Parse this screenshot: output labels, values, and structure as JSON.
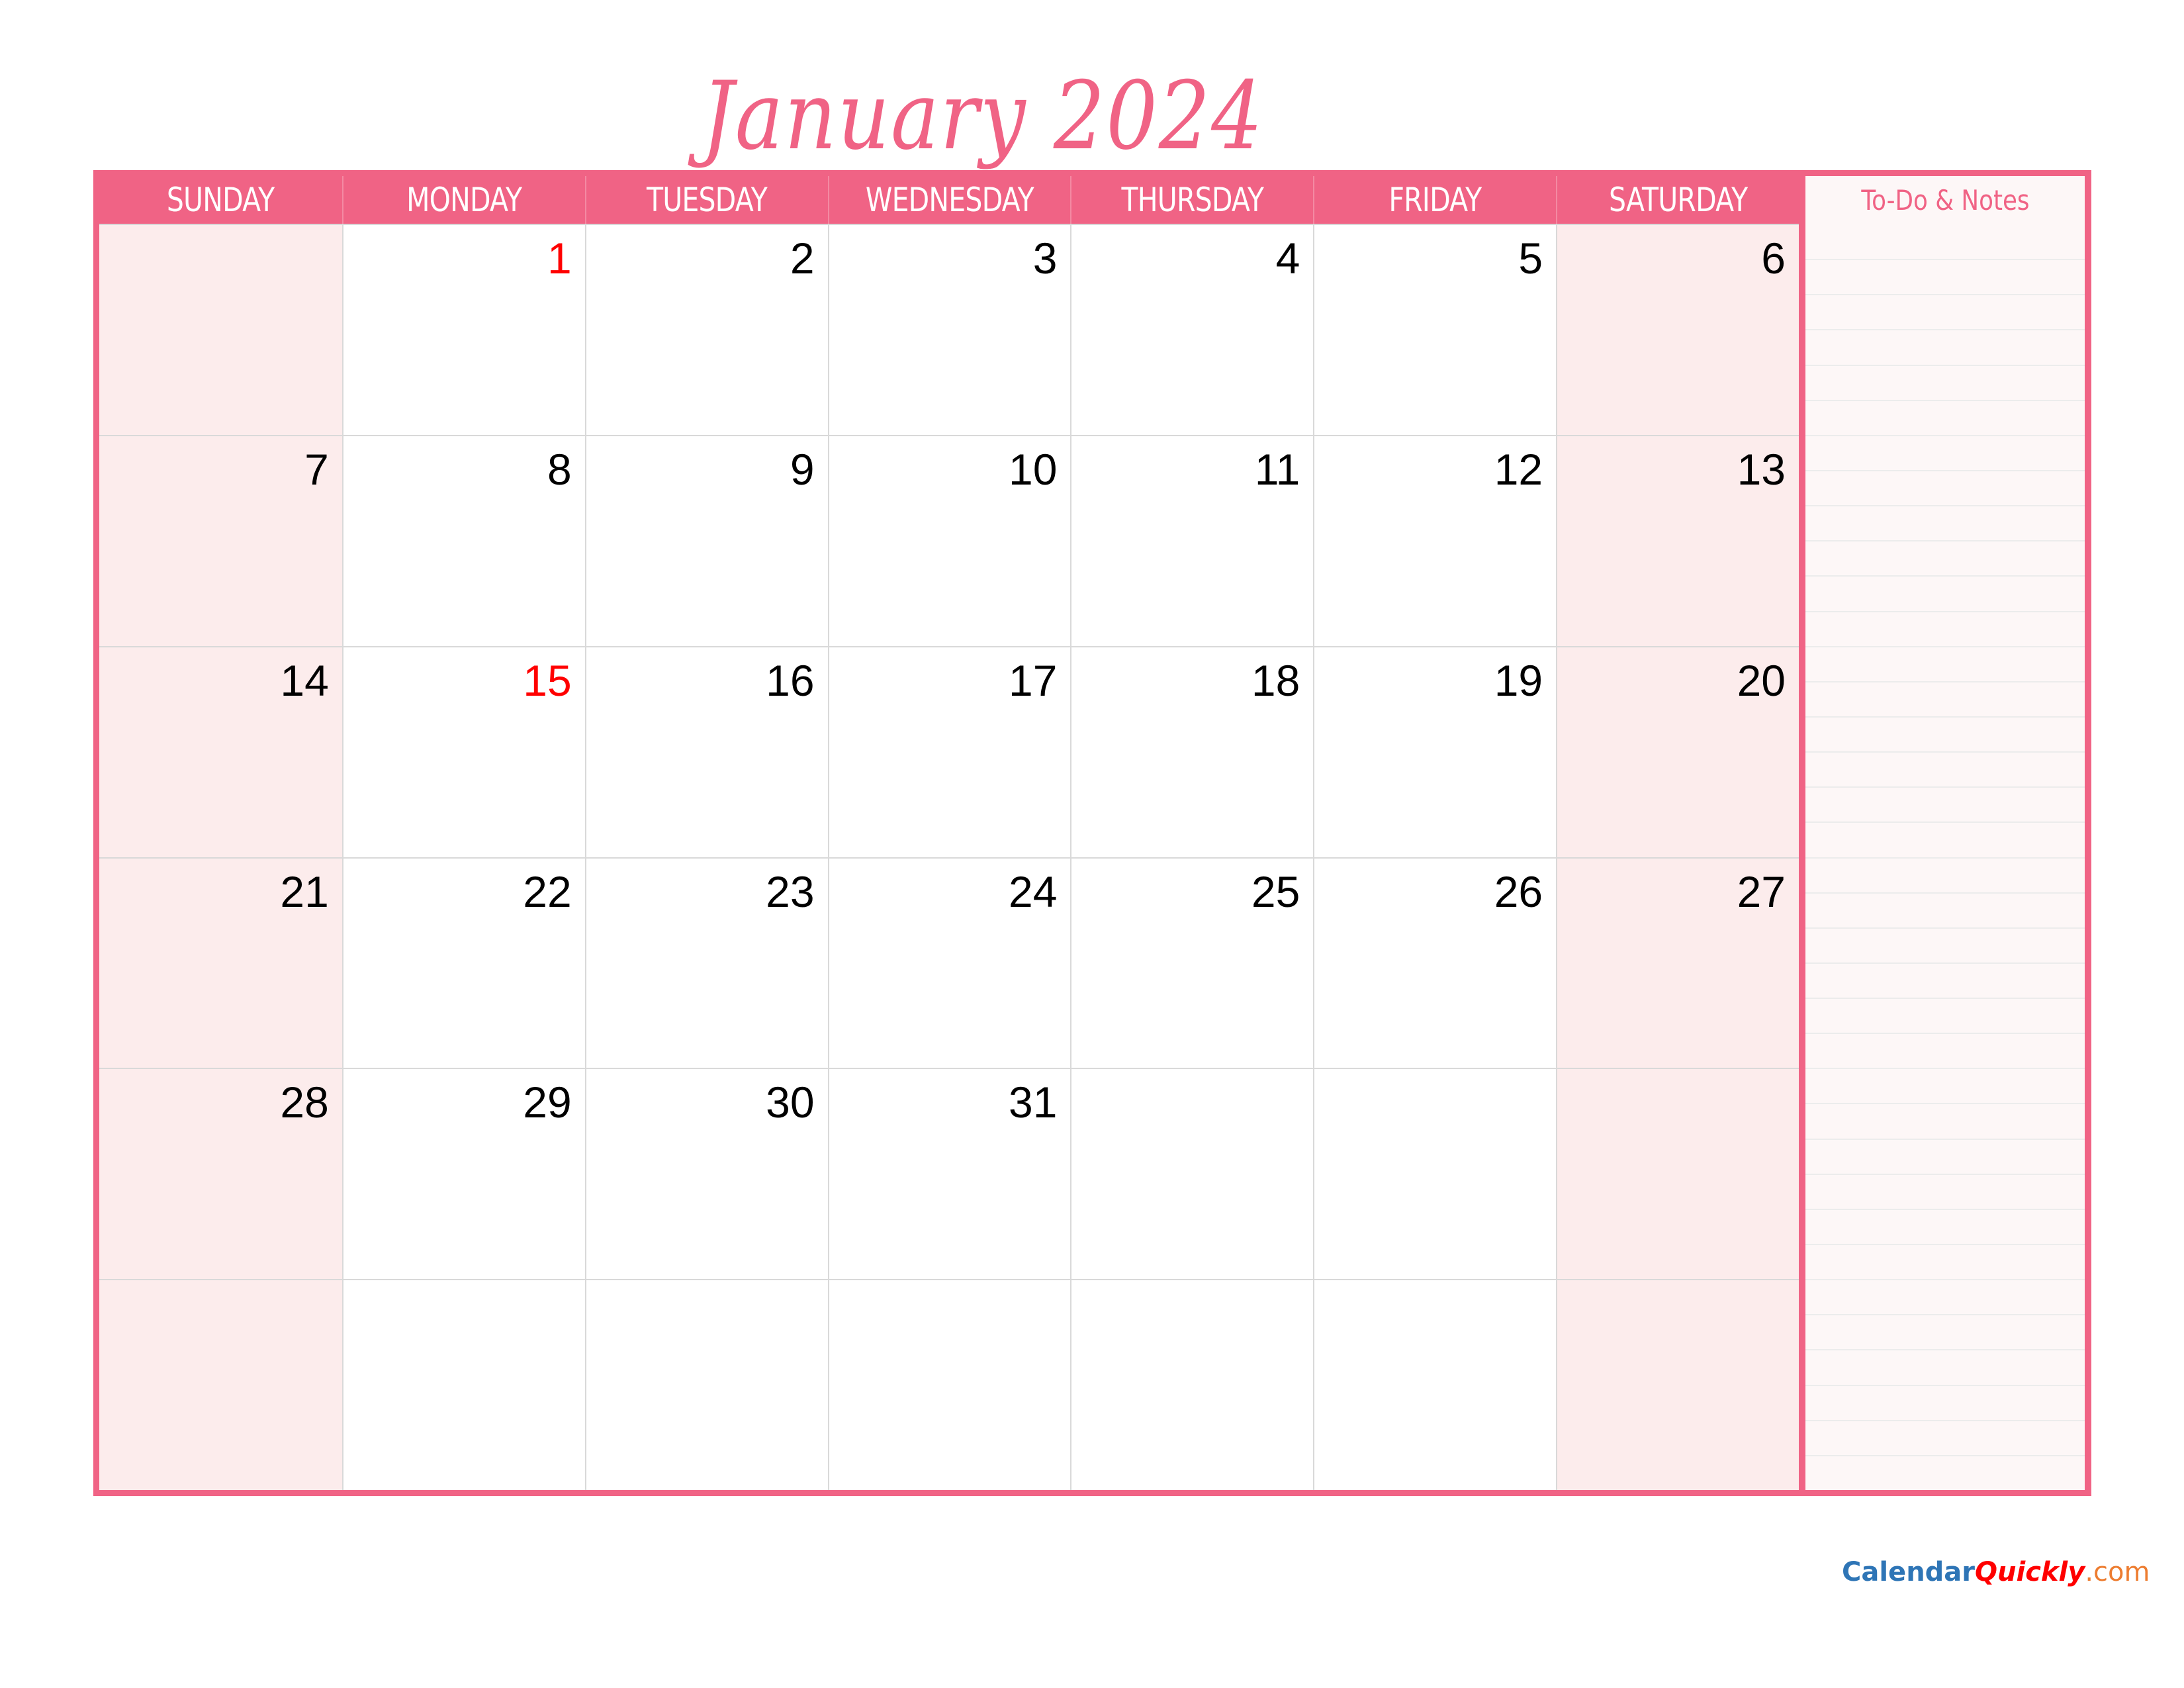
{
  "title": "January 2024",
  "weekdays": [
    "SUNDAY",
    "MONDAY",
    "TUESDAY",
    "WEDNESDAY",
    "THURSDAY",
    "FRIDAY",
    "SATURDAY"
  ],
  "weeks": [
    [
      "",
      "1",
      "2",
      "3",
      "4",
      "5",
      "6"
    ],
    [
      "7",
      "8",
      "9",
      "10",
      "11",
      "12",
      "13"
    ],
    [
      "14",
      "15",
      "16",
      "17",
      "18",
      "19",
      "20"
    ],
    [
      "21",
      "22",
      "23",
      "24",
      "25",
      "26",
      "27"
    ],
    [
      "28",
      "29",
      "30",
      "31",
      "",
      "",
      ""
    ],
    [
      "",
      "",
      "",
      "",
      "",
      "",
      ""
    ]
  ],
  "holidays": [
    "1",
    "15"
  ],
  "notes": {
    "title": "To-Do & Notes",
    "line_count": 36
  },
  "footer": {
    "part1": "Calendar",
    "part2": "Quickly",
    "part3": ".com"
  },
  "colors": {
    "accent": "#f06385",
    "weekend_bg": "#fcecec",
    "notes_bg": "#fdf7f7",
    "holiday": "#ff0000",
    "grid_line": "#d9d9d9"
  }
}
